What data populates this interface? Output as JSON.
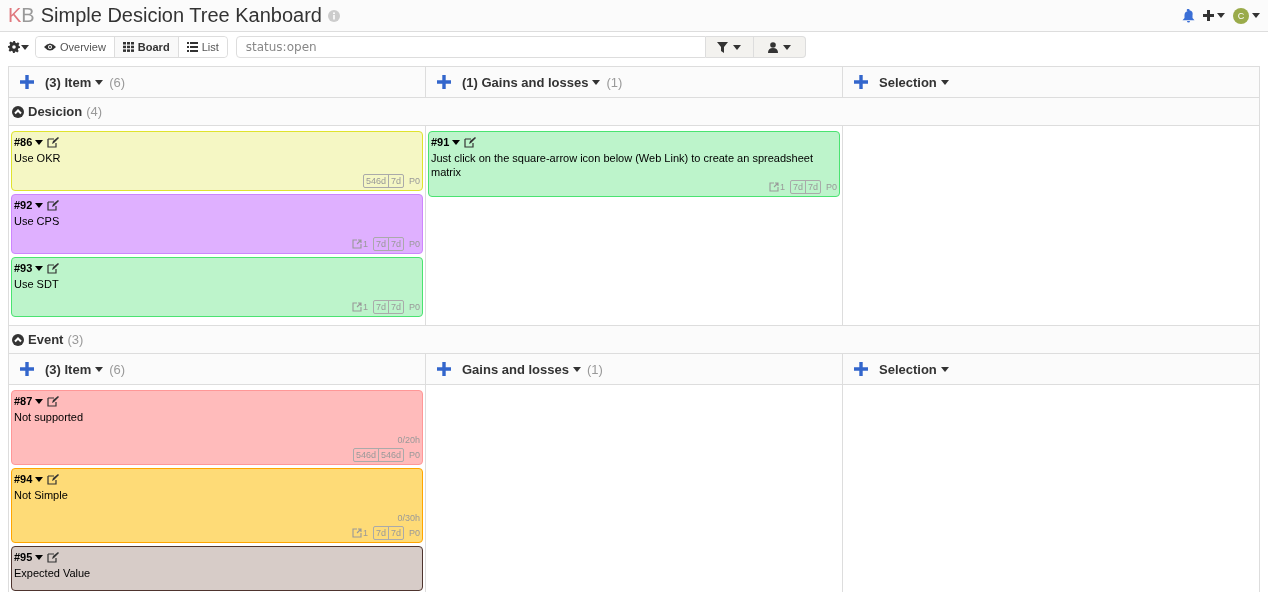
{
  "header": {
    "logo_parts": [
      "K",
      "B"
    ],
    "title": "Simple Desicion Tree Kanboard",
    "avatar_letter": "C"
  },
  "toolbar": {
    "views": [
      {
        "label": "Overview",
        "kind": "overview",
        "selected": false
      },
      {
        "label": "Board",
        "kind": "board",
        "selected": true
      },
      {
        "label": "List",
        "kind": "list",
        "selected": false
      }
    ],
    "search": {
      "value": "status:open"
    }
  },
  "swimlanes": [
    {
      "name": "Desicion",
      "count": "(4)",
      "expanded": true,
      "columns": [
        {
          "title": "(3) Item",
          "count": "(6)",
          "tasks": [
            {
              "id": "#86",
              "title": "Use OKR",
              "color": "#f5f7c4",
              "dates": [
                "546d",
                "7d"
              ],
              "priority": "P0"
            },
            {
              "id": "#92",
              "title": "Use CPS",
              "color": "#dfb0ff",
              "links": "1",
              "dates": [
                "7d",
                "7d"
              ],
              "priority": "P0"
            },
            {
              "id": "#93",
              "title": "Use SDT",
              "color": "#bdf4cb",
              "links": "1",
              "dates": [
                "7d",
                "7d"
              ],
              "priority": "P0"
            }
          ]
        },
        {
          "title": "(1) Gains and losses",
          "count": "(1)",
          "tasks": [
            {
              "id": "#91",
              "title": "Just click on the square-arrow icon below (Web Link) to create an spreadsheet matrix",
              "color": "#bdf4cb",
              "links": "1",
              "dates": [
                "7d",
                "7d"
              ],
              "priority": "P0"
            }
          ]
        },
        {
          "title": "Selection"
        }
      ]
    },
    {
      "name": "Event",
      "count": "(3)",
      "expanded": true,
      "columns": [
        {
          "title": "(3) Item",
          "count": "(6)",
          "tasks": [
            {
              "id": "#87",
              "title": "Not supported",
              "color": "#ffbbbb",
              "time": "0/20h",
              "dates": [
                "546d",
                "546d"
              ],
              "priority": "P0"
            },
            {
              "id": "#94",
              "title": "Not Simple",
              "color": "#fedb77",
              "time": "0/30h",
              "links": "1",
              "dates": [
                "7d",
                "7d"
              ],
              "priority": "P0"
            },
            {
              "id": "#95",
              "title": "Expected Value",
              "color": "#d7ccc8"
            }
          ]
        },
        {
          "title": "Gains and losses",
          "count": "(1)"
        },
        {
          "title": "Selection"
        }
      ]
    }
  ]
}
